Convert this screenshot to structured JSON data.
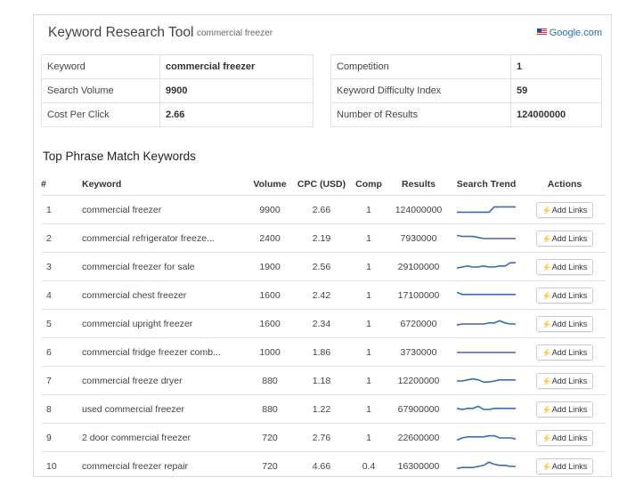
{
  "header": {
    "title": "Keyword Research Tool",
    "keyword": "commercial freezer",
    "source": "Google.com"
  },
  "stats_left": [
    {
      "label": "Keyword",
      "value": "commercial freezer"
    },
    {
      "label": "Search Volume",
      "value": "9900"
    },
    {
      "label": "Cost Per Click",
      "value": "2.66"
    }
  ],
  "stats_right": [
    {
      "label": "Competition",
      "value": "1"
    },
    {
      "label": "Keyword Difficulty Index",
      "value": "59"
    },
    {
      "label": "Number of Results",
      "value": "124000000"
    }
  ],
  "section_title": "Top Phrase Match Keywords",
  "columns": [
    "#",
    "Keyword",
    "Volume",
    "CPC (USD)",
    "Comp",
    "Results",
    "Search Trend",
    "Actions"
  ],
  "action_label": "Add Links",
  "trend_color": "#3a6ab0",
  "rows": [
    {
      "n": "1",
      "keyword": "commercial freezer",
      "volume": "9900",
      "cpc": "2.66",
      "comp": "1",
      "results": "124000000",
      "trend": [
        0.3,
        0.3,
        0.3,
        0.3,
        0.3,
        0.3,
        0.3,
        0.8,
        0.8,
        0.8,
        0.8,
        0.8
      ]
    },
    {
      "n": "2",
      "keyword": "commercial refrigerator freeze...",
      "volume": "2400",
      "cpc": "2.19",
      "comp": "1",
      "results": "7930000",
      "trend": [
        0.8,
        0.7,
        0.7,
        0.7,
        0.6,
        0.5,
        0.5,
        0.5,
        0.5,
        0.5,
        0.5,
        0.5
      ]
    },
    {
      "n": "3",
      "keyword": "commercial freezer for sale",
      "volume": "1900",
      "cpc": "2.56",
      "comp": "1",
      "results": "29100000",
      "trend": [
        0.4,
        0.5,
        0.6,
        0.5,
        0.5,
        0.6,
        0.5,
        0.5,
        0.6,
        0.6,
        0.9,
        0.9
      ]
    },
    {
      "n": "4",
      "keyword": "commercial chest freezer",
      "volume": "1600",
      "cpc": "2.42",
      "comp": "1",
      "results": "17100000",
      "trend": [
        0.8,
        0.6,
        0.6,
        0.6,
        0.6,
        0.6,
        0.6,
        0.6,
        0.6,
        0.6,
        0.6,
        0.6
      ]
    },
    {
      "n": "5",
      "keyword": "commercial upright freezer",
      "volume": "1600",
      "cpc": "2.34",
      "comp": "1",
      "results": "6720000",
      "trend": [
        0.4,
        0.5,
        0.5,
        0.5,
        0.5,
        0.5,
        0.6,
        0.6,
        0.8,
        0.6,
        0.5,
        0.5
      ]
    },
    {
      "n": "6",
      "keyword": "commercial fridge freezer comb...",
      "volume": "1000",
      "cpc": "1.86",
      "comp": "1",
      "results": "3730000",
      "trend": [
        0.5,
        0.5,
        0.5,
        0.5,
        0.5,
        0.5,
        0.5,
        0.5,
        0.5,
        0.5,
        0.5,
        0.5
      ]
    },
    {
      "n": "7",
      "keyword": "commercial freeze dryer",
      "volume": "880",
      "cpc": "1.18",
      "comp": "1",
      "results": "12200000",
      "trend": [
        0.5,
        0.5,
        0.6,
        0.7,
        0.6,
        0.4,
        0.4,
        0.5,
        0.6,
        0.6,
        0.6,
        0.6
      ]
    },
    {
      "n": "8",
      "keyword": "used commercial freezer",
      "volume": "880",
      "cpc": "1.22",
      "comp": "1",
      "results": "67900000",
      "trend": [
        0.6,
        0.5,
        0.6,
        0.6,
        0.8,
        0.5,
        0.5,
        0.6,
        0.6,
        0.6,
        0.6,
        0.6
      ]
    },
    {
      "n": "9",
      "keyword": "2 door commercial freezer",
      "volume": "720",
      "cpc": "2.76",
      "comp": "1",
      "results": "22600000",
      "trend": [
        0.3,
        0.5,
        0.6,
        0.6,
        0.6,
        0.6,
        0.7,
        0.7,
        0.5,
        0.5,
        0.5,
        0.4
      ]
    },
    {
      "n": "10",
      "keyword": "commercial freezer repair",
      "volume": "720",
      "cpc": "4.66",
      "comp": "0.4",
      "results": "16300000",
      "trend": [
        0.3,
        0.4,
        0.4,
        0.4,
        0.5,
        0.6,
        0.9,
        0.7,
        0.6,
        0.6,
        0.5,
        0.5
      ]
    }
  ]
}
